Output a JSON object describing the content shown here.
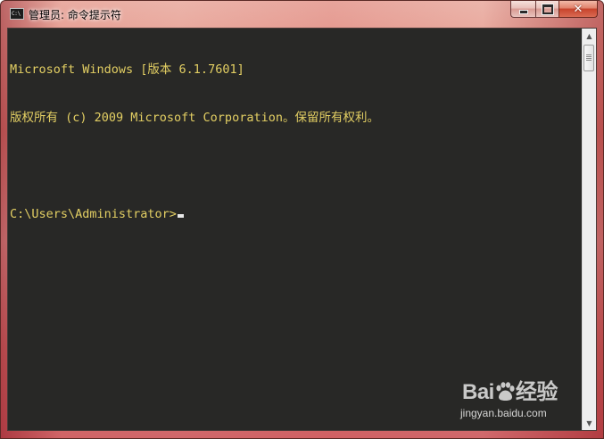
{
  "window": {
    "title": "管理员: 命令提示符",
    "icon": "cmd-icon",
    "icon_text": "C:\\",
    "buttons": {
      "minimize": "minimize-icon",
      "maximize": "maximize-icon",
      "close": "close-icon"
    }
  },
  "console": {
    "lines": [
      "Microsoft Windows [版本 6.1.7601]",
      "版权所有 (c) 2009 Microsoft Corporation。保留所有权利。",
      "",
      "C:\\Users\\Administrator>"
    ],
    "text_color": "#e3cf63",
    "background_color": "#282826"
  },
  "scrollbar": {
    "up_arrow": "▲",
    "down_arrow": "▼"
  },
  "watermark": {
    "logo_text_left": "Bai",
    "logo_text_right": "经验",
    "sub_text": "jingyan.baidu.com"
  }
}
